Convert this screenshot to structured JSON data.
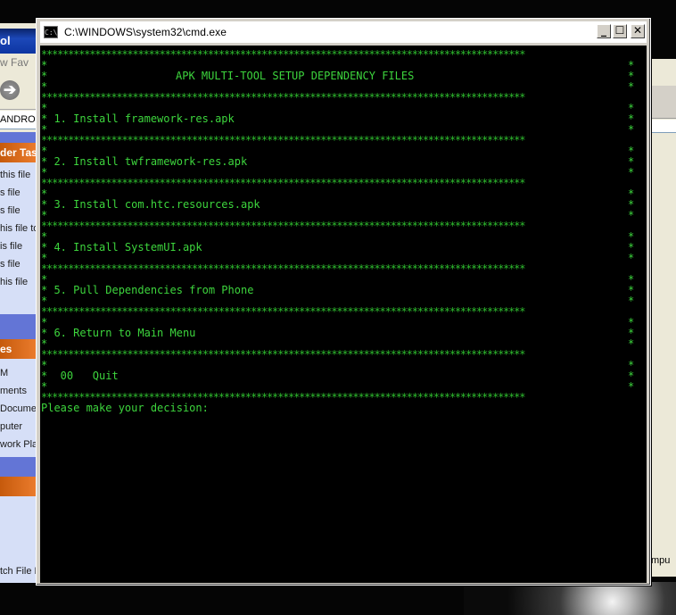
{
  "background_explorer": {
    "title_fragment": "ol",
    "menu_fragment": "w",
    "menu_fragment2": "Fav",
    "address_fragment": "ANDROI",
    "tasks_header": "der Tas",
    "tasks": [
      "this file",
      "s file",
      "s file",
      "his file to",
      "is file",
      "s file",
      "his file"
    ],
    "places_header": "es",
    "places": [
      "M",
      "ments",
      "Documen",
      "puter",
      "work Plac"
    ],
    "details_fragment": "tch File D",
    "right_fragment": "mpu"
  },
  "cmd": {
    "title": "C:\\WINDOWS\\system32\\cmd.exe",
    "icon_glyph": "C:\\",
    "btn_min": "_",
    "btn_max": "☐",
    "btn_close": "✕",
    "header": "APK MULTI-TOOL SETUP DEPENDENCY FILES",
    "menu": [
      "* 1. Install framework-res.apk",
      "* 2. Install twframework-res.apk",
      "* 3. Install com.htc.resources.apk",
      "* 4. Install SystemUI.apk",
      "* 5. Pull Dependencies from Phone",
      "* 6. Return to Main Menu",
      "*  00   Quit"
    ],
    "prompt": "Please make your decision:"
  }
}
